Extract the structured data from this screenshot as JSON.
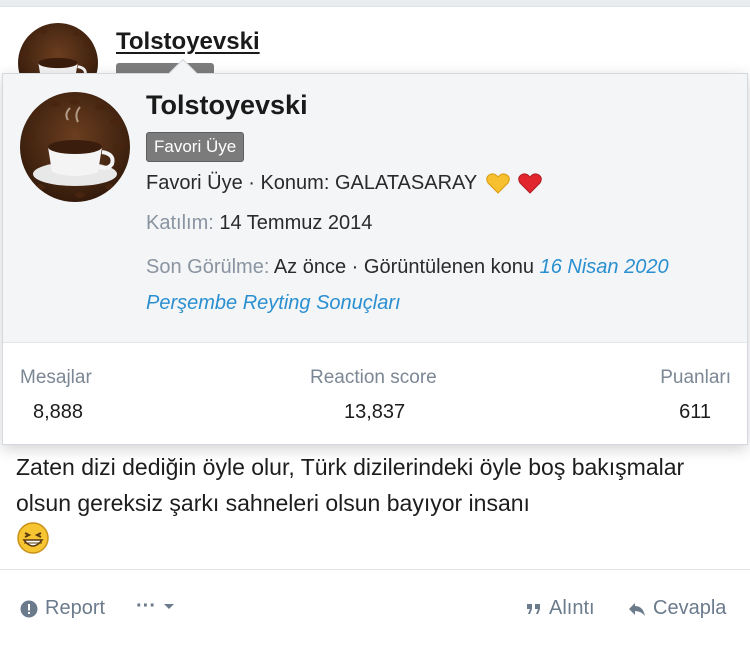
{
  "post": {
    "username": "Tolstoyevski",
    "body_text": "Zaten dizi dediğin öyle olur, Türk dizilerindeki öyle boş bakışmalar olsun gereksiz şarkı sahneleri olsun bayıyor insanı",
    "body_emoji": "laughing-face"
  },
  "tooltip": {
    "name": "Tolstoyevski",
    "badge": "Favori Üye",
    "title_line": "Favori Üye · Konum: GALATASARAY",
    "location_emojis": [
      "yellow-heart",
      "red-heart"
    ],
    "joined_label": "Katılım:",
    "joined_value": "14 Temmuz 2014",
    "last_seen_label": "Son Görülme:",
    "last_seen_value": "Az önce · Görüntülenen konu",
    "last_seen_link_part1": "16 Nisan 2020",
    "last_seen_link_part2": "Perşembe Reyting Sonuçları",
    "stats": [
      {
        "label": "Mesajlar",
        "value": "8,888"
      },
      {
        "label": "Reaction score",
        "value": "13,837"
      },
      {
        "label": "Puanları",
        "value": "611"
      }
    ]
  },
  "actions": {
    "report": "Report",
    "more": "···",
    "quote": "Alıntı",
    "reply": "Cevapla"
  },
  "colors": {
    "link": "#2a8fd0",
    "muted": "#8a94a0",
    "badge_bg": "#7b7b7b",
    "action": "#6b7b8c"
  }
}
